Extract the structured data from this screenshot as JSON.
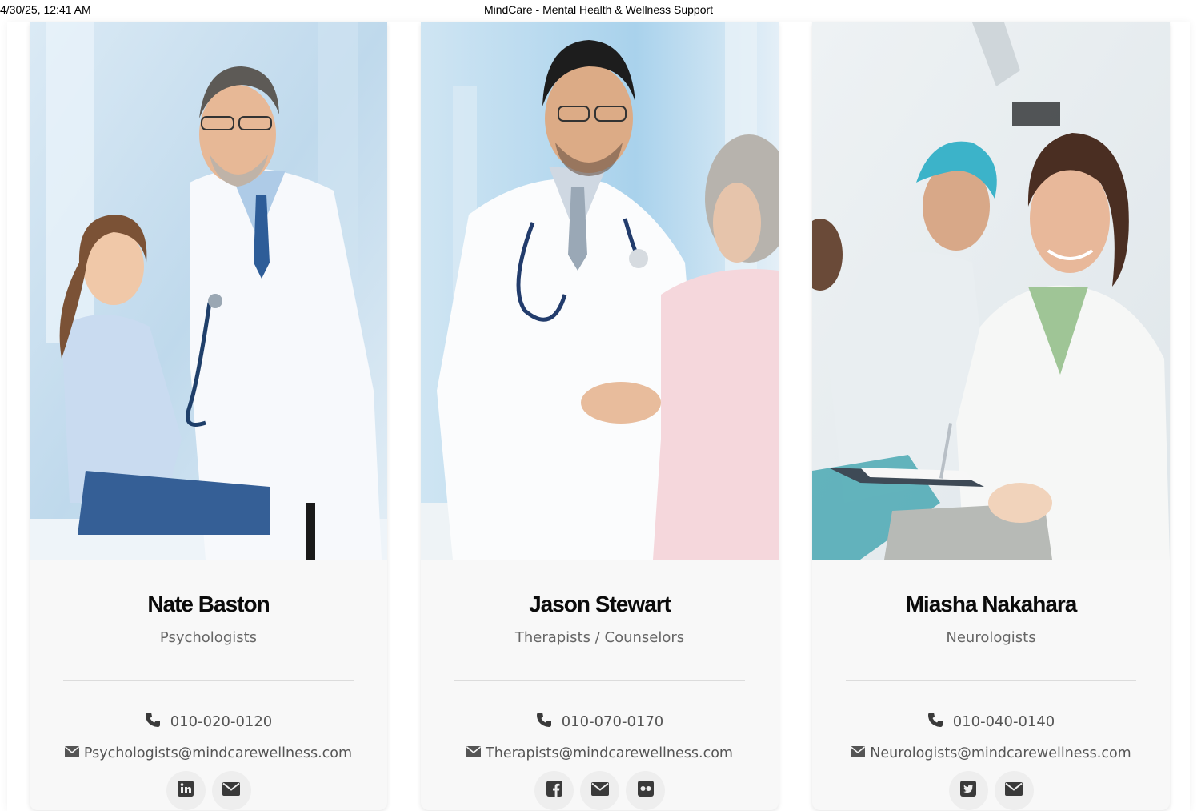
{
  "print_header": {
    "datetime": "4/30/25, 12:41 AM",
    "title": "MindCare - Mental Health & Wellness Support"
  },
  "team": [
    {
      "name": "Nate Baston",
      "role": "Psychologists",
      "phone": "010-020-0120",
      "email": "Psychologists@mindcarewellness.com",
      "photo": "doctor with child patient",
      "socials": [
        "linkedin-icon",
        "envelope-icon"
      ]
    },
    {
      "name": "Jason Stewart",
      "role": "Therapists / Counselors",
      "phone": "010-070-0170",
      "email": "Therapists@mindcarewellness.com",
      "photo": "doctor greeting elderly patient",
      "socials": [
        "facebook-icon",
        "envelope-icon",
        "flickr-icon"
      ]
    },
    {
      "name": "Miasha Nakahara",
      "role": "Neurologists",
      "phone": "010-040-0140",
      "email": "Neurologists@mindcarewellness.com",
      "photo": "doctor with clipboard in clinic",
      "socials": [
        "twitter-icon",
        "envelope-icon"
      ]
    }
  ],
  "colors": {
    "card_bg": "#f8f8f8",
    "text_dark": "#0b0b0b",
    "text_muted": "#666666",
    "icon": "#3a3a3a",
    "social_bg": "#eeeeee"
  }
}
